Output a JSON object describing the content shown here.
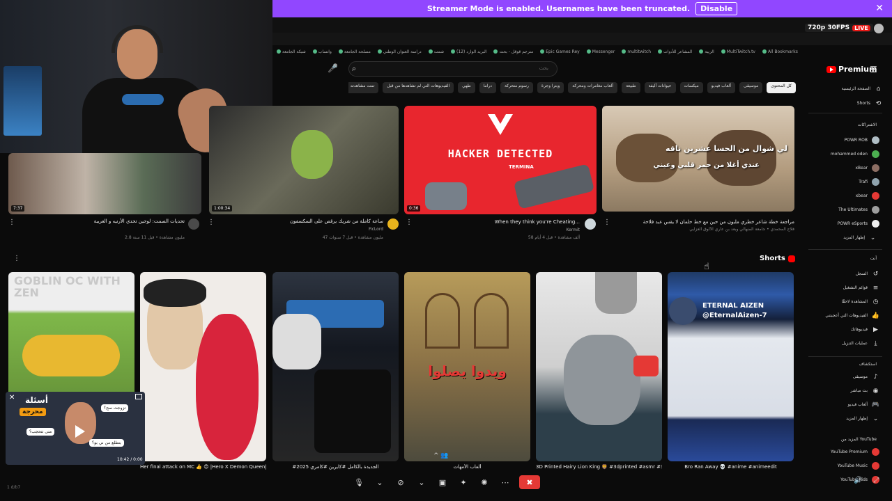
{
  "banner": {
    "text": "Streamer Mode is enabled. Usernames have been truncated.",
    "disable_label": "Disable",
    "close": "✕",
    "color": "#9147ff"
  },
  "stream_badge": {
    "quality": "720p 30FPS",
    "live": "LIVE"
  },
  "bookmarks": [
    "شبكة الجامعة",
    "واتساب",
    "مصلحة الجامعة",
    "دراسة العنوان الوطني",
    "شمت",
    "البريد الوارد (12)",
    "مترجم قوقل - بحث",
    "Epic Games Rey",
    "Messenger",
    "multitwitch",
    "المشاعر للأدوات",
    "الزيبة",
    "MultiTwitch.tv",
    "All Bookmarks"
  ],
  "youtube": {
    "brand": "Premium",
    "search_placeholder": "بحث",
    "chips": [
      "كل المحتوى",
      "موسيقى",
      "ألعاب فيديو",
      "ميكسات",
      "حيوانات أليفة",
      "طبيعة",
      "ألعاب مغامرات ومحركة",
      "ويترا وجرة",
      "رسوم متحركة",
      "دراما",
      "طهي",
      "الفيديوهات التي لم تشاهدها من قبل",
      "تمت مشاهدته",
      "محتوى جديد لك"
    ],
    "sidebar": {
      "home": "الصفحة الرئيسية",
      "shorts": "Shorts",
      "subs_header": "الاشتراكات",
      "subs": [
        "POWR ROB",
        "mohammed oden",
        "xBear",
        "Trafi",
        "xbear",
        "The Ultimates",
        "POWR eSports"
      ],
      "show_more": "إظهار المزيد",
      "you_header": "أنت",
      "you_items": [
        "السجل",
        "قوائم التشغيل",
        "المشاهدة لاحقًا",
        "الفيديوهات التي أعجبتني",
        "فيديوهاتك",
        "عمليات التنزيل"
      ],
      "explore_header": "استكشاف",
      "explore_items": [
        "موسيقى",
        "بث مباشر",
        "ألعاب فيديو",
        "إظهار المزيد"
      ],
      "more_header": "المزيد من YouTube",
      "more_items": [
        "YouTube Premium",
        "YouTube Music",
        "YouTube Kids"
      ]
    },
    "row1": [
      {
        "title": "تحديات الصمت: لوجين تحدي الأرنيه و الغريبة",
        "channel": "MrmGames",
        "meta": "2.8 مليون مشاهدة • قبل 11 سنة",
        "duration": "7:37"
      },
      {
        "title": "ساعة كاملة من شريك يرقص على السكسفون",
        "channel": "FicLord",
        "meta": "47 مليون مشاهدة • قبل 7 سنوات",
        "duration": "1:00:34"
      },
      {
        "title": "When they think you're Cheating...",
        "channel": "Kermit",
        "meta": "58 ألف مشاهدة • قبل 4 أيام",
        "duration": "0:36"
      },
      {
        "title": "مراجعة خطة شاعر خطري ملبون من حين مع خط حلمان لا يقس عبد فلاحة",
        "channel": "الأهل المحمدي",
        "meta": "فلاح المحمدي • جامعة المنهالي وبعد بن عاري الألوق العزايي",
        "duration": ""
      }
    ],
    "hacker_text": "HACKER DETECTED",
    "hacker_sub": "TERMINA",
    "camel_text1": "لي شوال من الحسا عشرين ناقه",
    "camel_text2": "عندي أغلا من حمر قلبي وعيني",
    "shorts_label": "Shorts",
    "shorts": [
      {
        "title": "Her final attack on MC 👍 😍 |Hero X Demon Queen| #manhwa #manhua #manhwaedit",
        "art": "GOBLIN OC WITH ZEN"
      },
      {
        "title": "Her final attack on MC 👍 😍 |Hero X Demon Queen| #manhwa #manhua #manhwaedit",
        "art": ""
      },
      {
        "title": "#2025 الجديدة بالكامل #كايرين #كامري",
        "art": ""
      },
      {
        "title": "ألعاب الأمهات",
        "art": "ويدوا يصلوا"
      },
      {
        "title": "3D Printed Hairy Lion King 🦁 #3dprinted #asmr #3dprint #thelionking #lionking",
        "art": ""
      },
      {
        "title": "Bro Ran Away 💀 #anime #animeedit",
        "art": "ETERNAL AIZEN @EternalAizen-7"
      }
    ],
    "popup": {
      "question": "أسئلة",
      "tag": "محرجة",
      "bubble1": "تزوجت سح؟",
      "bubble2": "بتطلع من ني بو؟",
      "bubble3": "متى تتحجب؟",
      "time": "10:42 / 0:00"
    }
  },
  "status_bar": "‏1 d/b7"
}
